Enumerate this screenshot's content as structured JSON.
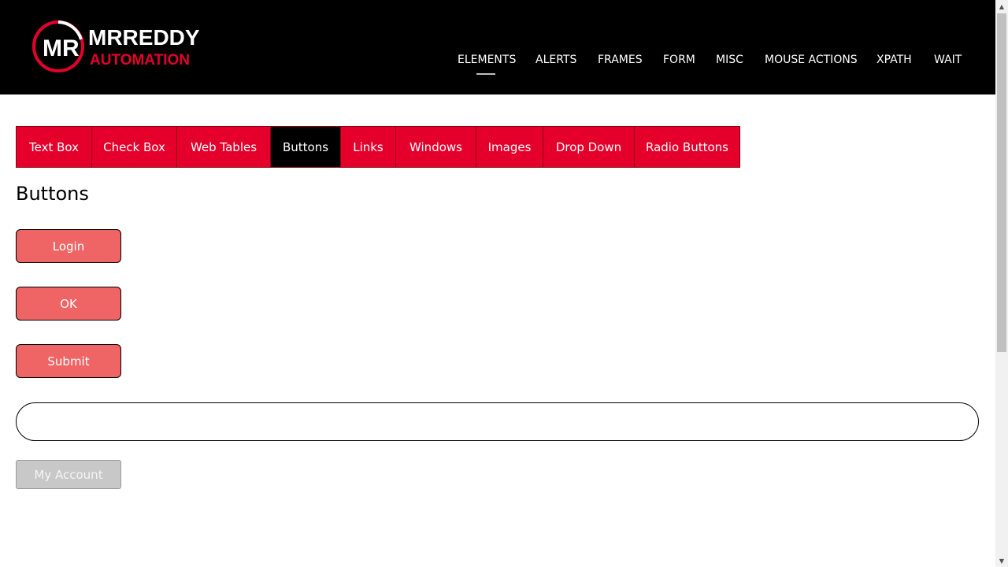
{
  "brand": {
    "monogram": "MR",
    "line1": "MRREDDY",
    "line2": "AUTOMATION",
    "colors": {
      "primary_red": "#e4002b",
      "white": "#ffffff",
      "black": "#000000"
    }
  },
  "nav": {
    "items": [
      {
        "label": "ELEMENTS",
        "active": true
      },
      {
        "label": "ALERTS"
      },
      {
        "label": "FRAMES"
      },
      {
        "label": "FORM"
      },
      {
        "label": "MISC"
      },
      {
        "label": "MOUSE ACTIONS"
      },
      {
        "label": "XPATH"
      },
      {
        "label": "WAIT"
      }
    ]
  },
  "tabs": {
    "items": [
      {
        "label": "Text Box"
      },
      {
        "label": "Check Box"
      },
      {
        "label": "Web Tables"
      },
      {
        "label": "Buttons",
        "active": true
      },
      {
        "label": "Links"
      },
      {
        "label": "Windows"
      },
      {
        "label": "Images"
      },
      {
        "label": "Drop Down"
      },
      {
        "label": "Radio Buttons"
      }
    ]
  },
  "page": {
    "title": "Buttons"
  },
  "buttons": {
    "login_label": "Login",
    "ok_label": "OK",
    "submit_label": "Submit",
    "my_account_label": "My Account"
  },
  "input": {
    "value": "",
    "placeholder": ""
  },
  "colors": {
    "button_fill": "#ef6464",
    "active_tab": "#000000",
    "disabled_button": "#c8c8c8"
  }
}
